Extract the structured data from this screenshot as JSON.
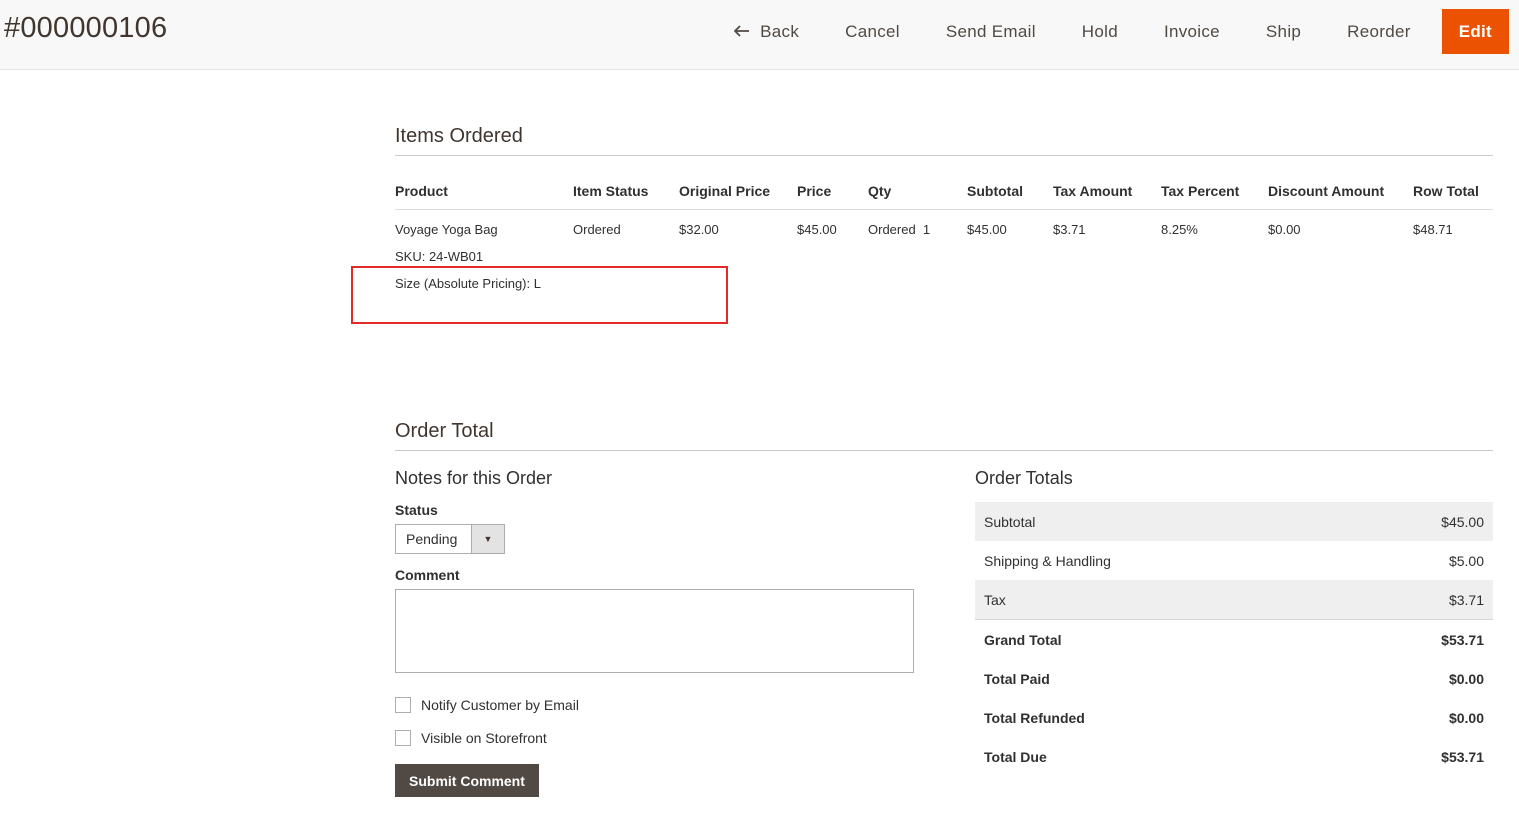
{
  "header": {
    "order_number": "#000000106",
    "actions": {
      "back": "Back",
      "cancel": "Cancel",
      "send_email": "Send Email",
      "hold": "Hold",
      "invoice": "Invoice",
      "ship": "Ship",
      "reorder": "Reorder",
      "edit": "Edit"
    },
    "edit_color": "#eb5202"
  },
  "items_ordered": {
    "title": "Items Ordered",
    "columns": [
      "Product",
      "Item Status",
      "Original Price",
      "Price",
      "Qty",
      "Subtotal",
      "Tax Amount",
      "Tax Percent",
      "Discount Amount",
      "Row Total"
    ],
    "rows": [
      {
        "product": "Voyage Yoga Bag",
        "sku": "SKU: 24-WB01",
        "option": "Size (Absolute Pricing): L",
        "item_status": "Ordered",
        "original_price": "$32.00",
        "price": "$45.00",
        "qty": "Ordered  1",
        "subtotal": "$45.00",
        "tax_amount": "$3.71",
        "tax_percent": "8.25%",
        "discount_amount": "$0.00",
        "row_total": "$48.71"
      }
    ]
  },
  "order_total": {
    "title": "Order Total",
    "notes": {
      "title": "Notes for this Order",
      "status_label": "Status",
      "status_value": "Pending",
      "comment_label": "Comment",
      "comment_value": "",
      "notify_label": "Notify Customer by Email",
      "visible_label": "Visible on Storefront",
      "submit_label": "Submit Comment"
    },
    "totals": {
      "title": "Order Totals",
      "rows": [
        {
          "label": "Subtotal",
          "value": "$45.00"
        },
        {
          "label": "Shipping & Handling",
          "value": "$5.00"
        },
        {
          "label": "Tax",
          "value": "$3.71"
        },
        {
          "label": "Grand Total",
          "value": "$53.71"
        },
        {
          "label": "Total Paid",
          "value": "$0.00"
        },
        {
          "label": "Total Refunded",
          "value": "$0.00"
        },
        {
          "label": "Total Due",
          "value": "$53.71"
        }
      ]
    }
  }
}
